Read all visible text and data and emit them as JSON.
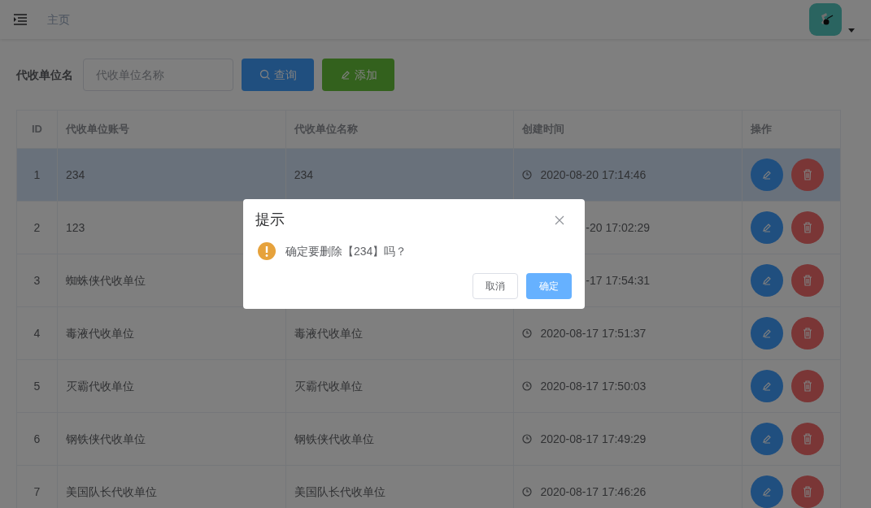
{
  "header": {
    "breadcrumb": "主页"
  },
  "search": {
    "label": "代收单位名",
    "placeholder": "代收单位名称",
    "query_button": "查询",
    "add_button": "添加"
  },
  "table": {
    "columns": [
      "ID",
      "代收单位账号",
      "代收单位名称",
      "创建时间",
      "操作"
    ],
    "rows": [
      {
        "id": "1",
        "account": "234",
        "name": "234",
        "time": "2020-08-20 17:14:46",
        "selected": true
      },
      {
        "id": "2",
        "account": "123",
        "time": "-20 17:02:29",
        "time_clipped": true,
        "selected": false
      },
      {
        "id": "3",
        "account": "蜘蛛侠代收单位",
        "time": "-17 17:54:31",
        "time_clipped": true,
        "selected": false
      },
      {
        "id": "4",
        "account": "毒液代收单位",
        "name": "毒液代收单位",
        "time": "2020-08-17 17:51:37",
        "selected": false
      },
      {
        "id": "5",
        "account": "灭霸代收单位",
        "name": "灭霸代收单位",
        "time": "2020-08-17 17:50:03",
        "selected": false
      },
      {
        "id": "6",
        "account": "钢铁侠代收单位",
        "name": "钢铁侠代收单位",
        "time": "2020-08-17 17:49:29",
        "selected": false
      },
      {
        "id": "7",
        "account": "美国队长代收单位",
        "name": "美国队长代收单位",
        "time": "2020-08-17 17:46:26",
        "selected": false
      }
    ]
  },
  "dialog": {
    "title": "提示",
    "message": "确定要删除【234】吗？",
    "cancel": "取消",
    "confirm": "确定"
  }
}
